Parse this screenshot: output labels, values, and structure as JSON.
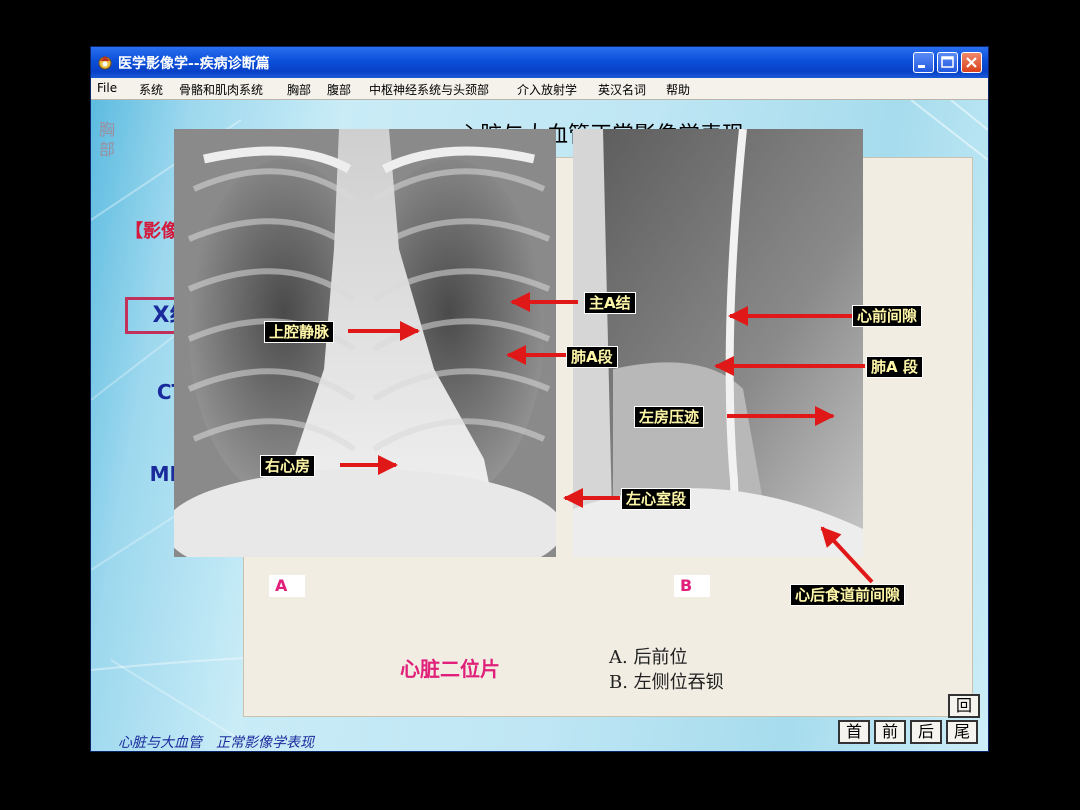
{
  "window": {
    "title": "医学影像学--疾病诊断篇"
  },
  "menu": [
    "File",
    "系统",
    "骨骼和肌肉系统",
    "胸部",
    "腹部",
    "中枢神经系统与头颈部",
    "介入放射学",
    "英汉名词",
    "帮助"
  ],
  "sidebar": {
    "section": "胸部",
    "heading": "【影像学】",
    "items": [
      "X线",
      "CT",
      "MRI"
    ],
    "selected": "X线"
  },
  "page_title": "心脏与大血管正常影像学表现",
  "image_a": {
    "corner": "A",
    "labels": {
      "svc": "上腔静脉",
      "aortic_knob": "主A结",
      "pulm_a": "肺A段",
      "right_atrium": "右心房",
      "left_ventricle": "左心室段"
    }
  },
  "image_b": {
    "corner": "B",
    "labels": {
      "retrosternal": "心前间隙",
      "pulm_a": "肺A 段",
      "la_impression": "左房压迹",
      "retrocardiac": "心后食道前间隙"
    }
  },
  "caption": {
    "main": "心脏二位片",
    "line_a": "A. 后前位",
    "line_b": "B. 左侧位吞钡"
  },
  "nav_buttons": {
    "back": "回",
    "first": "首",
    "prev": "前",
    "next": "后",
    "last": "尾"
  },
  "footer": "心脏与大血管　正常影像学表现",
  "colors": {
    "title_bar": "#0b4fd8",
    "tag_text": "#fff7a8",
    "arrow": "#e01818",
    "accent_pink": "#e0207a",
    "nav_blue": "#1a2a9c"
  }
}
